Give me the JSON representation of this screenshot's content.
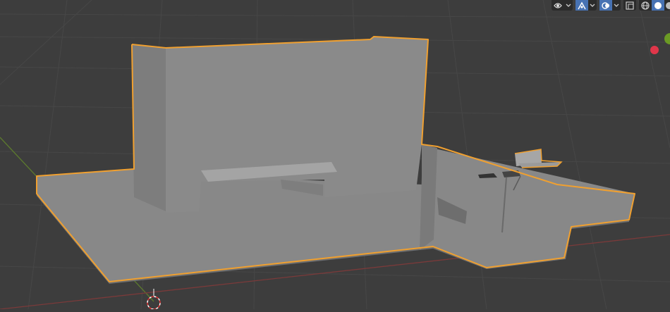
{
  "editor": {
    "name": "3D Viewport",
    "header": {
      "gizmo_toggle": {
        "icon": "gizmo-arrows-icon",
        "active": false
      },
      "overlay_toggle": {
        "icon": "overlay-circles-icon",
        "active": true
      },
      "xray_toggle": {
        "icon": "xray-icon",
        "active": false
      },
      "shading_modes": [
        "wireframe-icon",
        "solid-icon",
        "material-preview-icon"
      ],
      "active_shading": "solid-icon"
    }
  },
  "scene": {
    "object": "wall-with-floor-mesh",
    "selected": true
  },
  "colors": {
    "background": "#3d3d3d",
    "grid": "#474747",
    "x_axis": "#7a3a3a",
    "y_axis": "#5c7a2e",
    "selection_outline": "#f0a030",
    "mesh_light": "#888888",
    "mesh_dark": "#6f6f6f",
    "active_button": "#4772b3",
    "nav_gizmo_x": "#e0364a",
    "nav_gizmo_y": "#6b9a24"
  }
}
